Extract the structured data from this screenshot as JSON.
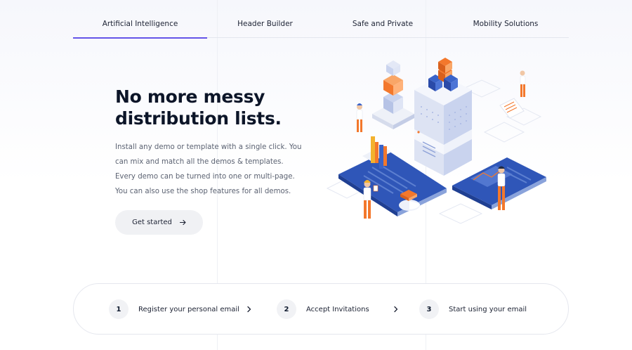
{
  "tabs": [
    {
      "label": "Artificial Intelligence",
      "active": true
    },
    {
      "label": "Header Builder",
      "active": false
    },
    {
      "label": "Safe and Private",
      "active": false
    },
    {
      "label": "Mobility Solutions",
      "active": false
    }
  ],
  "hero": {
    "title": "No more messy distribution lists.",
    "description": "Install any demo or template with a single click. You can mix and match all the demos & templates. Every demo can be turned into one or multi-page. You can also use the shop features for all demos.",
    "cta_label": "Get started",
    "cta_icon": "arrow-right-icon"
  },
  "steps": [
    {
      "number": "1",
      "label": "Register your personal email",
      "icon": "chevron-right-icon"
    },
    {
      "number": "2",
      "label": "Accept Invitations",
      "icon": "chevron-right-icon"
    },
    {
      "number": "3",
      "label": "Start using your email"
    }
  ],
  "colors": {
    "accent": "#6454e8",
    "blue": "#3a63c9",
    "orange": "#f3782c",
    "navy": "#0c1528"
  }
}
